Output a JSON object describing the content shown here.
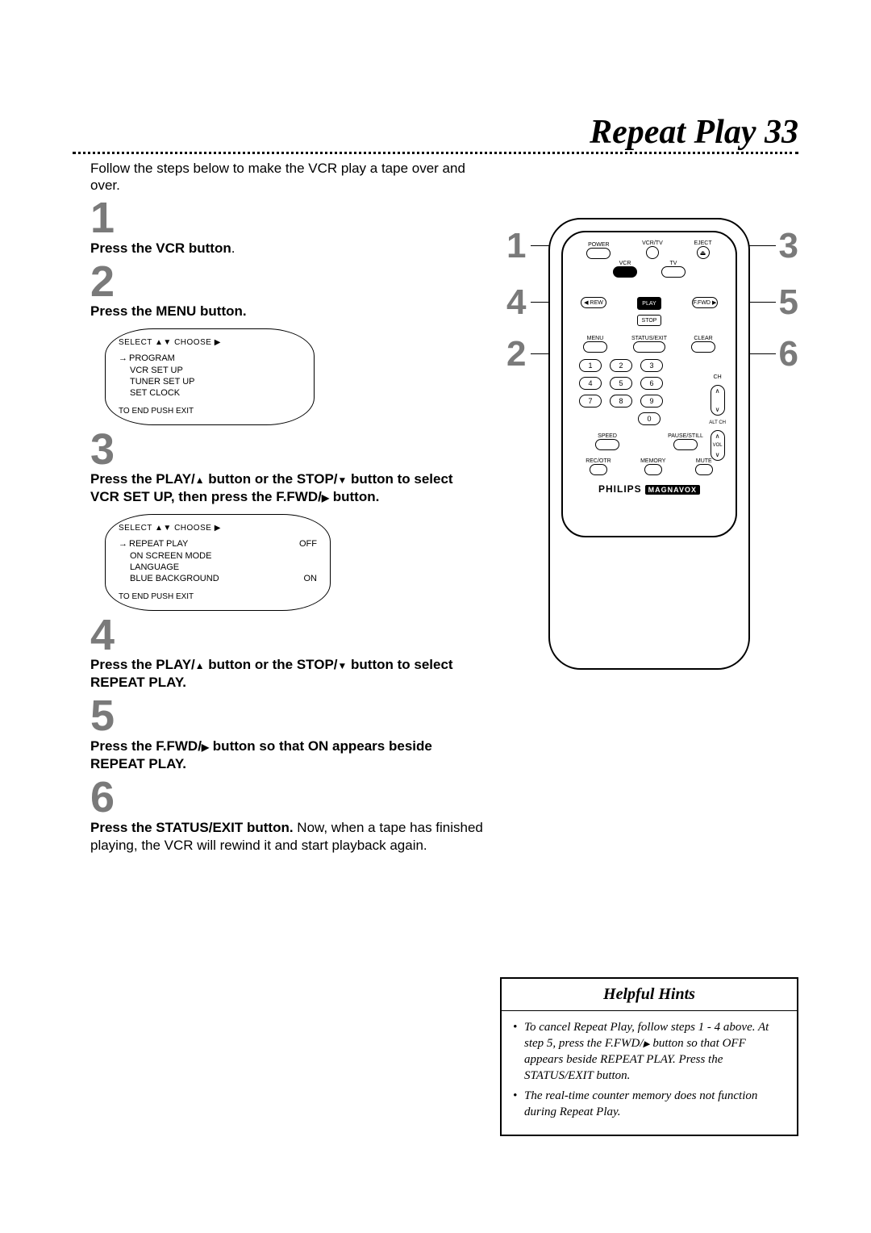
{
  "page": {
    "title_text": "Repeat Play",
    "title_num": "33",
    "intro": "Follow the steps below to make the VCR play a tape over and over."
  },
  "steps": {
    "s1": {
      "num": "1",
      "text_bold": "Press the VCR button",
      "text_after": "."
    },
    "s2": {
      "num": "2",
      "text_bold": "Press the MENU button."
    },
    "s3": {
      "num": "3",
      "line1a": "Press the PLAY/",
      "line1b": " button or the STOP/",
      "line1c": " button to select",
      "line2a": "VCR SET UP, then press the F.FWD/",
      "line2b": " button."
    },
    "s4": {
      "num": "4",
      "line1a": "Press the PLAY/",
      "line1b": " button or the STOP/",
      "line1c": " button to select",
      "line2": "REPEAT PLAY."
    },
    "s5": {
      "num": "5",
      "line1a": "Press the F.FWD/",
      "line1b": " button so that ON appears beside",
      "line2": "REPEAT PLAY."
    },
    "s6": {
      "num": "6",
      "bold": "Press the STATUS/EXIT button.",
      "rest": " Now, when a tape has finished playing, the VCR will rewind it and start playback again."
    }
  },
  "osd1": {
    "header": "SELECT ▲▼ CHOOSE ▶",
    "items": [
      "PROGRAM",
      "VCR SET UP",
      "TUNER SET UP",
      "SET CLOCK"
    ],
    "footer": "TO END PUSH EXIT"
  },
  "osd2": {
    "header": "SELECT ▲▼ CHOOSE ▶",
    "rows": [
      {
        "label": "REPEAT PLAY",
        "value": "OFF"
      },
      {
        "label": "ON SCREEN MODE",
        "value": ""
      },
      {
        "label": "LANGUAGE",
        "value": ""
      },
      {
        "label": "BLUE BACKGROUND",
        "value": "ON"
      }
    ],
    "footer": "TO END PUSH EXIT"
  },
  "remote": {
    "labels": {
      "power": "POWER",
      "vcrtv": "VCR/TV",
      "eject": "EJECT",
      "vcr": "VCR",
      "tv": "TV",
      "play": "PLAY",
      "rew": "REW",
      "ffwd": "F.FWD",
      "stop": "STOP",
      "menu": "MENU",
      "status": "STATUS/EXIT",
      "clear": "CLEAR",
      "ch": "CH",
      "altch": "ALT CH",
      "vol": "VOL",
      "speed": "SPEED",
      "pause": "PAUSE/STILL",
      "recotr": "REC/OTR",
      "memory": "MEMORY",
      "mute": "MUTE"
    },
    "nums": [
      "1",
      "2",
      "3",
      "4",
      "5",
      "6",
      "7",
      "8",
      "9",
      "0"
    ],
    "brand1": "PHILIPS",
    "brand2": "MAGNAVOX",
    "eject_glyph": "⏏"
  },
  "callouts": {
    "c1": "1",
    "c2": "2",
    "c3": "3",
    "c4": "4",
    "c5": "5",
    "c6": "6"
  },
  "hints": {
    "title": "Helpful Hints",
    "h1a": "To cancel Repeat Play, follow steps 1 - 4 above. At step 5, press the F.FWD/",
    "h1b": " button so that OFF appears beside REPEAT PLAY. Press the STATUS/EXIT button.",
    "h2": "The real-time counter memory does not function during Repeat Play."
  }
}
